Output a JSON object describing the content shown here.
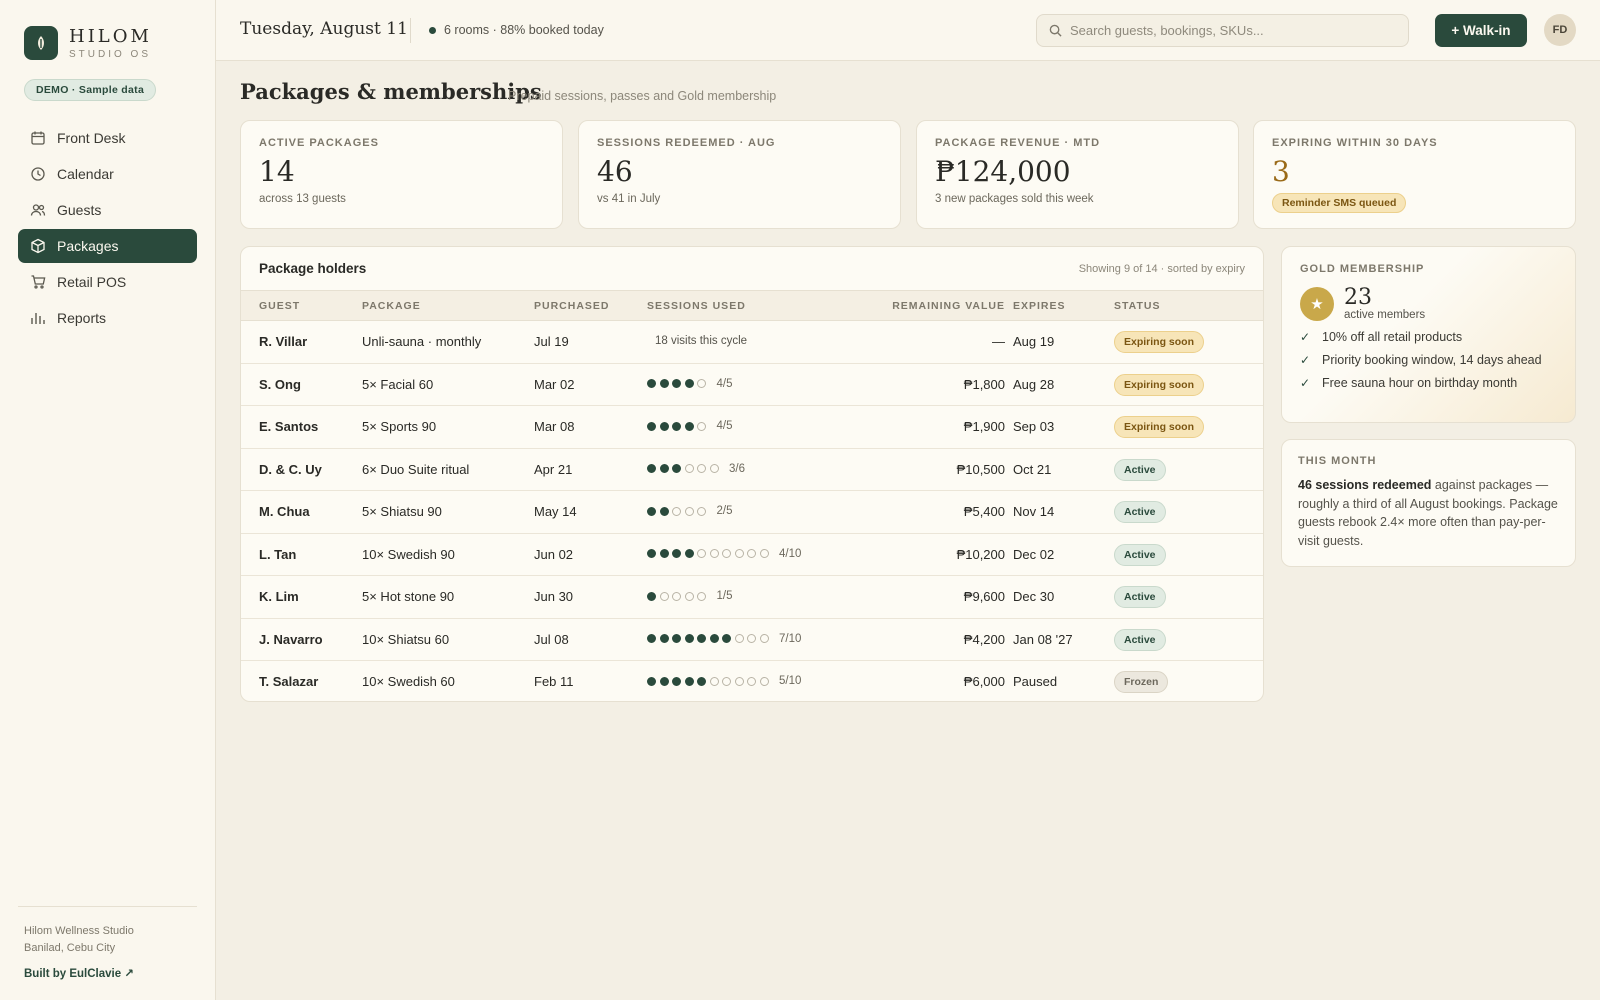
{
  "brand": {
    "name": "HILOM",
    "sub": "STUDIO OS",
    "demo": "DEMO · Sample data"
  },
  "nav": [
    {
      "label": "Front Desk",
      "icon": "calendar-icon",
      "active": false
    },
    {
      "label": "Calendar",
      "icon": "clock-icon",
      "active": false
    },
    {
      "label": "Guests",
      "icon": "users-icon",
      "active": false
    },
    {
      "label": "Packages",
      "icon": "package-icon",
      "active": true
    },
    {
      "label": "Retail POS",
      "icon": "cart-icon",
      "active": false
    },
    {
      "label": "Reports",
      "icon": "bar-chart-icon",
      "active": false
    }
  ],
  "sidebar_footer": {
    "line1": "Hilom Wellness Studio",
    "line2": "Banilad, Cebu City",
    "built": "Built by EulClavie ↗"
  },
  "topbar": {
    "date": "Tuesday, August 11",
    "status": "6 rooms · 88% booked today",
    "search_placeholder": "Search guests, bookings, SKUs...",
    "walkin": "+ Walk-in",
    "avatar": "FD"
  },
  "page": {
    "title": "Packages & memberships",
    "subtitle": "Prepaid sessions, passes and Gold membership"
  },
  "kpis": [
    {
      "label": "ACTIVE PACKAGES",
      "value": "14",
      "sub": "across 13 guests"
    },
    {
      "label": "SESSIONS REDEEMED · AUG",
      "value": "46",
      "sub": "vs 41 in July"
    },
    {
      "label": "PACKAGE REVENUE · MTD",
      "value": "₱124,000",
      "sub": "3 new packages sold this week"
    },
    {
      "label": "EXPIRING WITHIN 30 DAYS",
      "value": "3",
      "pill": "Reminder SMS queued"
    }
  ],
  "table": {
    "title": "Package holders",
    "meta": "Showing 9 of 14 · sorted by expiry",
    "columns": [
      "GUEST",
      "PACKAGE",
      "PURCHASED",
      "SESSIONS USED",
      "REMAINING VALUE",
      "EXPIRES",
      "STATUS"
    ],
    "rows": [
      {
        "guest": "R. Villar",
        "package": "Unli-sauna · monthly",
        "purchased": "Jul 19",
        "used": null,
        "total": null,
        "sessions_text": "18 visits this cycle",
        "remaining": "—",
        "expires": "Aug 19",
        "status": "Expiring soon",
        "status_type": "expiring"
      },
      {
        "guest": "S. Ong",
        "package": "5× Facial 60",
        "purchased": "Mar 02",
        "used": 4,
        "total": 5,
        "sessions_text": "4/5",
        "remaining": "₱1,800",
        "expires": "Aug 28",
        "status": "Expiring soon",
        "status_type": "expiring"
      },
      {
        "guest": "E. Santos",
        "package": "5× Sports 90",
        "purchased": "Mar 08",
        "used": 4,
        "total": 5,
        "sessions_text": "4/5",
        "remaining": "₱1,900",
        "expires": "Sep 03",
        "status": "Expiring soon",
        "status_type": "expiring"
      },
      {
        "guest": "D. & C. Uy",
        "package": "6× Duo Suite ritual",
        "purchased": "Apr 21",
        "used": 3,
        "total": 6,
        "sessions_text": "3/6",
        "remaining": "₱10,500",
        "expires": "Oct 21",
        "status": "Active",
        "status_type": "active"
      },
      {
        "guest": "M. Chua",
        "package": "5× Shiatsu 90",
        "purchased": "May 14",
        "used": 2,
        "total": 5,
        "sessions_text": "2/5",
        "remaining": "₱5,400",
        "expires": "Nov 14",
        "status": "Active",
        "status_type": "active"
      },
      {
        "guest": "L. Tan",
        "package": "10× Swedish 90",
        "purchased": "Jun 02",
        "used": 4,
        "total": 10,
        "sessions_text": "4/10",
        "remaining": "₱10,200",
        "expires": "Dec 02",
        "status": "Active",
        "status_type": "active"
      },
      {
        "guest": "K. Lim",
        "package": "5× Hot stone 90",
        "purchased": "Jun 30",
        "used": 1,
        "total": 5,
        "sessions_text": "1/5",
        "remaining": "₱9,600",
        "expires": "Dec 30",
        "status": "Active",
        "status_type": "active"
      },
      {
        "guest": "J. Navarro",
        "package": "10× Shiatsu 60",
        "purchased": "Jul 08",
        "used": 7,
        "total": 10,
        "sessions_text": "7/10",
        "remaining": "₱4,200",
        "expires": "Jan 08 '27",
        "status": "Active",
        "status_type": "active"
      },
      {
        "guest": "T. Salazar",
        "package": "10× Swedish 60",
        "purchased": "Feb 11",
        "used": 5,
        "total": 10,
        "sessions_text": "5/10",
        "remaining": "₱6,000",
        "expires": "Paused",
        "status": "Frozen",
        "status_type": "frozen"
      }
    ]
  },
  "gold": {
    "label": "GOLD MEMBERSHIP",
    "count": "23",
    "caption": "active members",
    "perks": [
      "10% off all retail products",
      "Priority booking window, 14 days ahead",
      "Free sauna hour on birthday month"
    ]
  },
  "month": {
    "label": "THIS MONTH",
    "bold": "46 sessions redeemed",
    "text": " against packages — roughly a third of all August bookings. Package guests rebook 2.4× more often than pay-per-visit guests."
  },
  "colors": {
    "brand_green": "#2a4a3c",
    "gold": "#c9a84a",
    "warn": "#9a6a18",
    "background": "#f3efe4"
  }
}
